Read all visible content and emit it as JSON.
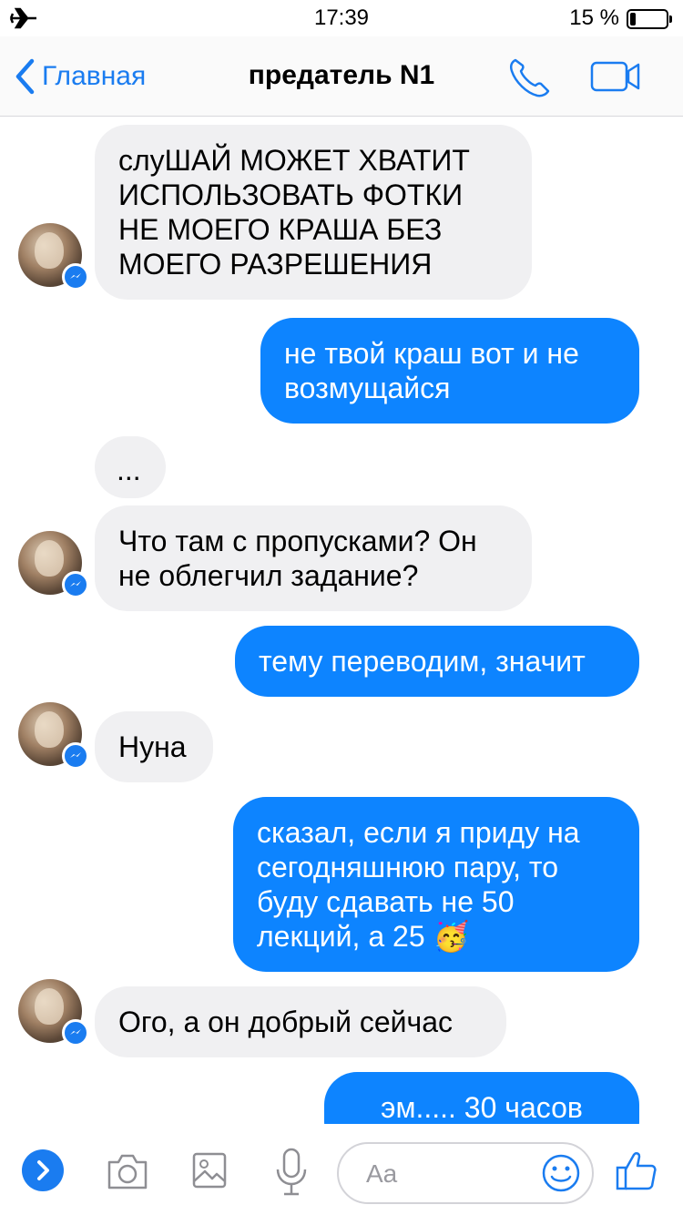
{
  "status_bar": {
    "time": "17:39",
    "battery_text": "15 %",
    "battery_level": 0.15,
    "airplane_icon": "airplane-icon"
  },
  "nav": {
    "back_label": "Главная",
    "title": "предатель N1",
    "phone_icon": "phone-icon",
    "video_icon": "video-camera-icon"
  },
  "messages": [
    {
      "sender": "them",
      "text": " слуШАЙ МОЖЕТ ХВАТИТ\nИСПОЛЬЗОВАТЬ ФОТКИ\nНЕ МОЕГО КРАША БЕЗ\nМОЕГО РАЗРЕШЕНИЯ",
      "avatar": true
    },
    {
      "sender": "me",
      "text": "не твой краш вот и не\nвозмущайся"
    },
    {
      "sender": "them",
      "text": "...",
      "avatar": false
    },
    {
      "sender": "them",
      "text": "Что там с пропусками? Он\nне облегчил задание?",
      "avatar": true
    },
    {
      "sender": "me",
      "text": "тему переводим, значит"
    },
    {
      "sender": "them",
      "text": "Нуна",
      "avatar": true
    },
    {
      "sender": "me",
      "text": "сказал, если я приду на\nсегодняшнюю пару, то\nбуду сдавать не 50\nлекций, а 25 🥳"
    },
    {
      "sender": "them",
      "text": "Ого, а он добрый сейчас",
      "avatar": true
    },
    {
      "sender": "me",
      "text": "эм..... 30 часов"
    }
  ],
  "composer": {
    "placeholder": "Aa",
    "value": ""
  },
  "colors": {
    "accent": "#1a7cf0",
    "outgoing_bubble": "#0d84ff",
    "incoming_bubble": "#f0f0f2"
  }
}
